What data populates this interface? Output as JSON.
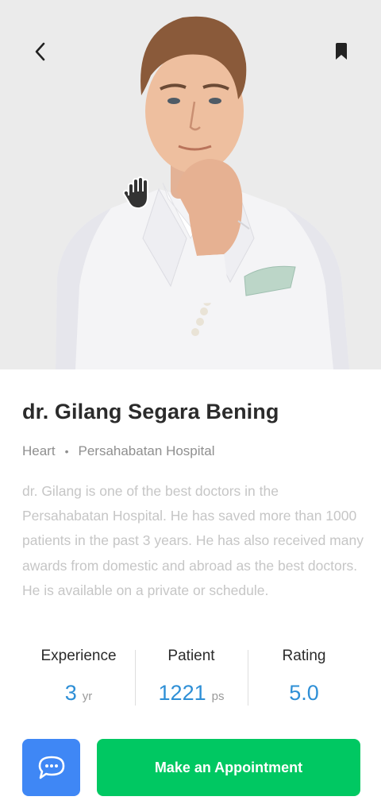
{
  "doctor": {
    "name": "dr. Gilang Segara Bening",
    "specialty": "Heart",
    "separator": "•",
    "hospital": "Persahabatan Hospital",
    "bio": "dr. Gilang is one of the best doctors in the Persahabatan Hospital. He has saved more than 1000 patients in the past 3 years. He has also received many awards from domestic and abroad as the best doctors. He is available on a private or schedule."
  },
  "stats": [
    {
      "label": "Experience",
      "value": "3",
      "unit": "yr"
    },
    {
      "label": "Patient",
      "value": "1221",
      "unit": "ps"
    },
    {
      "label": "Rating",
      "value": "5.0",
      "unit": ""
    }
  ],
  "actions": {
    "appointment_label": "Make an Appointment",
    "chat_icon": "chat-bubble-icon"
  },
  "colors": {
    "accent_blue": "#2e8fd6",
    "chat_button": "#3f87f5",
    "appointment_button": "#00c862",
    "hero_background": "#ebebeb"
  },
  "icons": {
    "back": "chevron-left-icon",
    "bookmark": "bookmark-icon",
    "cursor": "hand-cursor-icon"
  }
}
